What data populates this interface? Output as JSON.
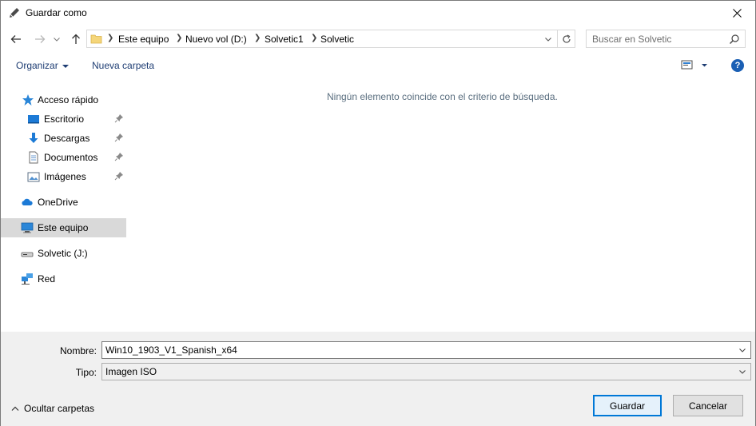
{
  "window": {
    "title": "Guardar como",
    "close_symbol": "✕"
  },
  "nav": {
    "breadcrumbs": [
      "Este equipo",
      "Nuevo vol (D:)",
      "Solvetic1",
      "Solvetic"
    ],
    "search_placeholder": "Buscar en Solvetic"
  },
  "toolbar": {
    "organize_label": "Organizar",
    "new_folder_label": "Nueva carpeta",
    "help_symbol": "?"
  },
  "sidebar": {
    "items": [
      {
        "label": "Acceso rápido",
        "icon": "star-icon"
      },
      {
        "label": "Escritorio",
        "icon": "desktop-icon"
      },
      {
        "label": "Descargas",
        "icon": "download-icon"
      },
      {
        "label": "Documentos",
        "icon": "document-icon"
      },
      {
        "label": "Imágenes",
        "icon": "pictures-icon"
      },
      {
        "label": "OneDrive",
        "icon": "cloud-icon"
      },
      {
        "label": "Este equipo",
        "icon": "computer-icon"
      },
      {
        "label": "Solvetic (J:)",
        "icon": "drive-icon"
      },
      {
        "label": "Red",
        "icon": "network-icon"
      }
    ],
    "selected": "Este equipo"
  },
  "main": {
    "empty_message": "Ningún elemento coincide con el criterio de búsqueda."
  },
  "form": {
    "name_label": "Nombre:",
    "name_value": "Win10_1903_V1_Spanish_x64",
    "type_label": "Tipo:",
    "type_value": "Imagen ISO"
  },
  "footer": {
    "hide_folders_label": "Ocultar carpetas",
    "save_label": "Guardar",
    "cancel_label": "Cancelar"
  },
  "colors": {
    "accent": "#0078d7",
    "link": "#1e3d73",
    "selected_bg": "#d9d9d9",
    "bottom_bg": "#f0f0f0"
  }
}
